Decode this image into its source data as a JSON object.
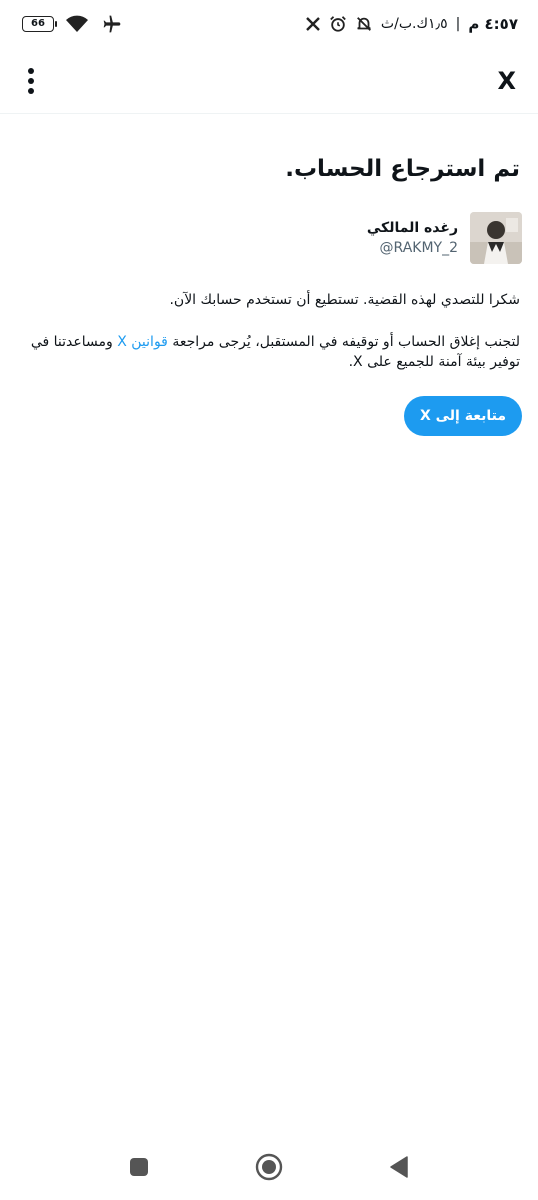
{
  "status_bar": {
    "time": "٤:٥٧ م",
    "carrier": "١٫٥ك.ب/ث",
    "battery": "66",
    "icons": [
      "wifi-icon",
      "airplane-icon",
      "x-logo-icon",
      "alarm-icon",
      "mute-icon"
    ]
  },
  "app_bar": {
    "close_label": "X",
    "more_icon": "more-vertical-icon"
  },
  "content": {
    "title": "تم استرجاع الحساب.",
    "account": {
      "name": "رغده المالكي",
      "handle": "@RAKMY_2"
    },
    "paragraph1": "شكرا للتصدي لهذه القضية. تستطيع أن تستخدم حسابك الآن.",
    "paragraph2_before": "لتجنب إغلاق الحساب أو توقيفه في المستقبل، يُرجى مراجعة ",
    "paragraph2_link": "قوانين X",
    "paragraph2_after": " ومساعدتنا في توفير بيئة آمنة للجميع على X.",
    "continue_button": "متابعة إلى X"
  },
  "colors": {
    "accent": "#1d9bf0",
    "text": "#0f1419",
    "secondary_text": "#536471"
  },
  "nav_bar": {
    "icons": [
      "back-icon",
      "home-icon",
      "recents-icon"
    ]
  }
}
